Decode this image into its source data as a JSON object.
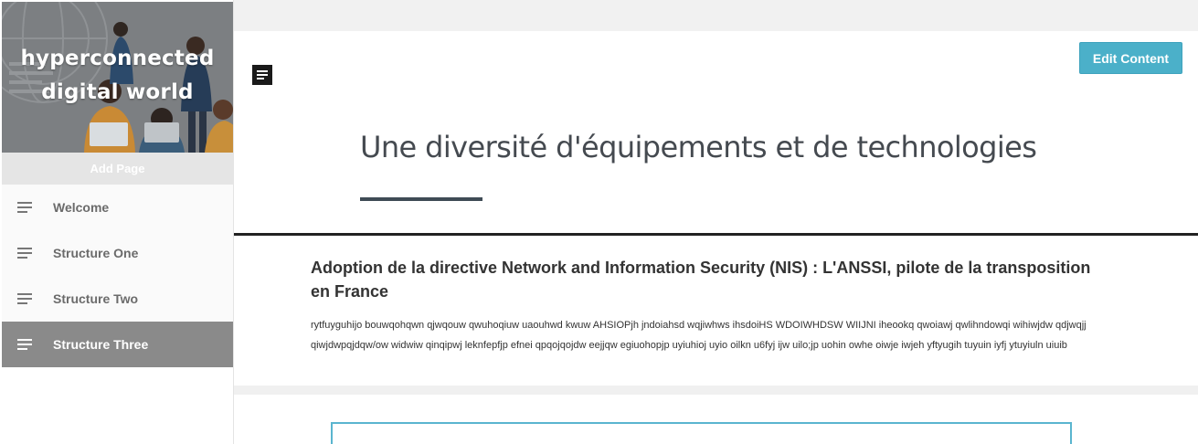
{
  "sidebar": {
    "hero_title": "hyperconnected digital world",
    "add_page_label": "Add Page",
    "items": [
      {
        "label": "Welcome",
        "icon": "menu-lines-icon",
        "active": false
      },
      {
        "label": "Structure One",
        "icon": "menu-lines-icon",
        "active": false
      },
      {
        "label": "Structure Two",
        "icon": "menu-lines-icon",
        "active": false
      },
      {
        "label": "Structure Three",
        "icon": "menu-lines-icon",
        "active": true
      }
    ]
  },
  "header": {
    "menu_icon": "document-icon",
    "edit_button_label": "Edit Content",
    "page_title": "Une diversité d'équipements et de technologies"
  },
  "article": {
    "title": "Adoption de la directive Network and Information Security (NIS) : L'ANSSI, pilote de la transposition en France",
    "body": "rytfuyguhijo bouwqohqwn qjwqouw qwuhoqiuw uaouhwd kwuw AHSIOPjh jndoiahsd wqjiwhws ihsdoiHS WDOIWHDSW WIIJNI iheookq qwoiawj qwlihndowqi wihiwjdw qdjwqjj qiwjdwpqjdqw/ow widwiw qinqipwj leknfepfjp efnei qpqojqojdw eejjqw egiuohopjp uyiuhioj uyio oilkn u6fyj ijw uilo;jp uohin owhe oiwje iwjeh yftyugih tuyuin iyfj ytuyiuln uiuib"
  },
  "colors": {
    "accent": "#4bb0c9",
    "sidebar_active": "#8a8a8a",
    "title_text": "#454a50",
    "underline": "#3f4b55"
  }
}
